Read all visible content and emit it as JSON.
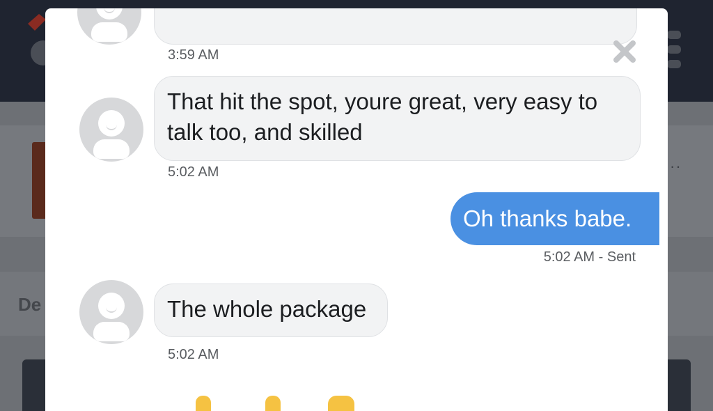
{
  "background": {
    "partial_text": "De",
    "more_indicator": "··"
  },
  "modal": {
    "messages": [
      {
        "id": "msg-prev",
        "direction": "incoming",
        "text": "",
        "time": "3:59 AM"
      },
      {
        "id": "msg-1",
        "direction": "incoming",
        "text_line1": "That hit the spot, youre great, very easy to",
        "text_line2": "talk too, and skilled",
        "time": "5:02 AM"
      },
      {
        "id": "msg-2",
        "direction": "outgoing",
        "text": "Oh thanks babe.",
        "time": "5:02 AM - Sent"
      },
      {
        "id": "msg-3",
        "direction": "incoming",
        "text": "The whole package",
        "time": "5:02 AM"
      }
    ],
    "close_icon": "close-icon",
    "avatar_icon": "default-user-avatar-icon"
  },
  "colors": {
    "outgoing_bubble": "#4a90e2",
    "incoming_bubble": "#f2f3f4",
    "header_bg": "#1f2430"
  }
}
